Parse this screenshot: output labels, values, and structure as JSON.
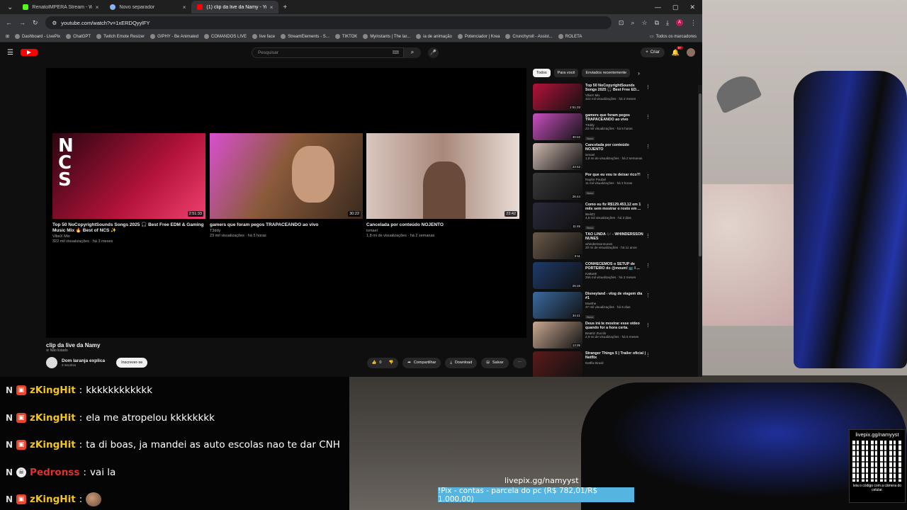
{
  "tabs": [
    {
      "title": "RenatoIMPERA Stream - Wi",
      "color": "#53fc18",
      "active": false
    },
    {
      "title": "Novo separador",
      "color": "#8ab4f8",
      "active": false
    },
    {
      "title": "(1) clip da live da Namy - YouT",
      "color": "#ff0000",
      "active": true
    }
  ],
  "address": {
    "url": "youtube.com/watch?v=1xERDQyylFY"
  },
  "bookmarks": [
    "Dashboard - LivePix",
    "ChatGPT",
    "Twitch Emote Resizer",
    "GIPHY - Be Animated",
    "COMANDOS LIVE",
    "live face",
    "StreamElements - S...",
    "TIKTOK",
    "Myinstants | The lar...",
    "ia de animação",
    "Potenciador | Krea",
    "Crunchyroll - Assist...",
    "ROLETA"
  ],
  "bookmarks_right": "Todos os marcadores",
  "youtube": {
    "search_placeholder": "Pesquisar",
    "create_label": "Criar",
    "notif_count": "9+",
    "endcards": [
      {
        "title": "Top 50 NoCopyrightSounds Songs 2025 🎧 Best Free EDM & Gaming Music Mix 🔥 Best of NCS ✨",
        "channel": "VibeX Mix",
        "meta": "322 mil visualizações · há 3 meses",
        "duration": "2:51:33",
        "c1": "#b3123a",
        "c2": "#2a0610"
      },
      {
        "title": "gamers que foram pegos TRAPACEANDO ao vivo",
        "channel": "T3ddy",
        "meta": "23 mil visualizações · há 5 horas",
        "duration": "30:22",
        "c1": "#d94fd0",
        "c2": "#3a2a1e"
      },
      {
        "title": "Cancelada por conteúdo NOJENTO",
        "channel": "ismael",
        "meta": "1,8 mi de visualizações · há 2 semanas",
        "duration": "23:42",
        "c1": "#d8c6bf",
        "c2": "#8a6a5a"
      }
    ],
    "video_title": "clip da live da Namy",
    "video_status": "Não listado",
    "channel_name": "Dom laranja explica",
    "channel_subs": "3 inscritos",
    "subscribe": "Inscrever-se",
    "likes": "0",
    "share": "Compartilhar",
    "download": "Download",
    "save": "Salvar",
    "chips": [
      "Todos",
      "Para você",
      "Enviados recentemente"
    ],
    "recs": [
      {
        "title": "Top 50 NoCopyrightSounds Songs 2025 🎧 Best Free ED...",
        "channel": "VibeX Mix",
        "meta": "322 mil visualizações · há 3 meses",
        "duration": "2:51:33",
        "badge": "",
        "c": "#b3123a"
      },
      {
        "title": "gamers que foram pegos TRAPACEANDO ao vivo",
        "channel": "T3ddy",
        "meta": "23 mil visualizações · há 5 horas",
        "duration": "30:22",
        "badge": "Novo",
        "c": "#c94fc0"
      },
      {
        "title": "Cancelada por conteúdo NOJENTO",
        "channel": "ismael",
        "meta": "1,8 mi de visualizações · há 2 semanas",
        "duration": "23:42",
        "badge": "",
        "c": "#cdb8b0"
      },
      {
        "title": "Por que eu vou te deixar rico?!",
        "channel": "Rayfer Poubel",
        "meta": "11 mil visualizações · há 3 horas",
        "duration": "26:44",
        "badge": "Novo",
        "c": "#3a3a3a"
      },
      {
        "title": "Como eu fiz R$129.453,12 em 1 mês sem mostrar o rosto em ...",
        "channel": "iBeliZz",
        "meta": "4,8 mil visualizações · há 2 dias",
        "duration": "11:45",
        "badge": "Novo",
        "c": "#2a2a3a"
      },
      {
        "title": "TÃO LINDA 🎶 - WHINDERSSON NUNES",
        "channel": "whinderssonnunes",
        "meta": "20 mi de visualizações · há 11 anos",
        "duration": "3:11",
        "badge": "",
        "c": "#6a5a4a"
      },
      {
        "title": "CONHECEMOS o SETUP de PORTEIRO do @moum! 📺 I ...",
        "channel": "KaBuM!",
        "meta": "256 mil visualizações · há 3 meses",
        "duration": "26:15",
        "badge": "",
        "c": "#1e3a6a"
      },
      {
        "title": "Disneyland - vlog de viagem dia #1",
        "channel": "Moethe",
        "meta": "37 mil visualizações · há 6 dias",
        "duration": "34:41",
        "badge": "Novo",
        "c": "#3a6aa0"
      },
      {
        "title": "Deus irá te mostrar esse vídeo quando for a hora certa.",
        "channel": "Beatriz Zucolo",
        "meta": "2,9 mi de visualizações · há 5 meses",
        "duration": "13:35",
        "badge": "",
        "c": "#c8a890"
      },
      {
        "title": "Stranger Things 5 | Trailer oficial | Netflix",
        "channel": "Netflix Brasil",
        "meta": "",
        "duration": "",
        "badge": "",
        "c": "#5a1a1a"
      }
    ]
  },
  "chat": [
    {
      "prefix": "N",
      "icon": "ib",
      "user": "zKingHit",
      "color": "#f5c518",
      "text": "kkkkkkkkkkkk"
    },
    {
      "prefix": "N",
      "icon": "ib",
      "user": "zKingHit",
      "color": "#f5c518",
      "text": "ela me atropelou kkkkkkkk"
    },
    {
      "prefix": "N",
      "icon": "ib",
      "user": "zKingHit",
      "color": "#f5c518",
      "text": "ta di boas, ja mandei as auto escolas nao te dar CNH"
    },
    {
      "prefix": "N",
      "icon": "sk",
      "user": "Pedronss",
      "color": "#e0312a",
      "text": "vai la"
    },
    {
      "prefix": "N",
      "icon": "ib",
      "user": "zKingHit",
      "color": "#f5c518",
      "text": ""
    }
  ],
  "overlay": {
    "pix_url": "livepix.gg/namyyst",
    "goal": "!Pix - contas - parcela do pc (R$ 782,01/R$ 1.000,00)",
    "qr_title": "livepix.gg/namyyst",
    "qr_footer": "leia o código com a câmera do celular."
  }
}
